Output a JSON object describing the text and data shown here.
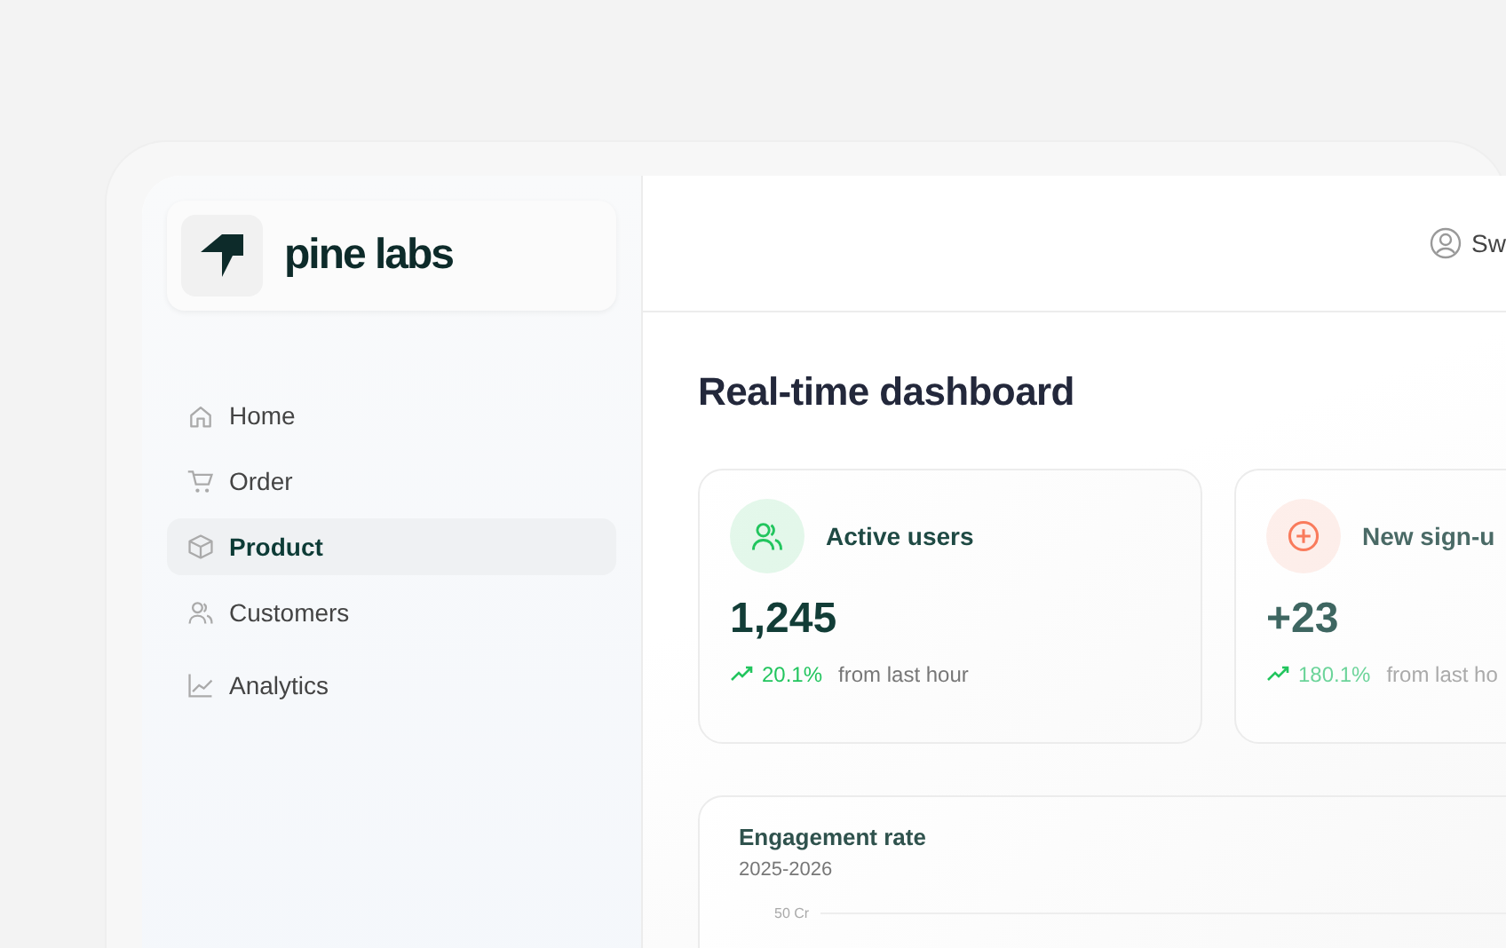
{
  "sidebar": {
    "logo_text": "pine labs",
    "items": [
      {
        "label": "Home",
        "selected": false
      },
      {
        "label": "Order",
        "selected": false
      },
      {
        "label": "Product",
        "selected": true
      },
      {
        "label": "Customers",
        "selected": false
      },
      {
        "label": "Analytics",
        "selected": false
      }
    ]
  },
  "header": {
    "user_name": "Sw"
  },
  "page_title": "Real-time dashboard",
  "stats": [
    {
      "title": "Active users",
      "color": "#22c55e",
      "value": "1,245",
      "change": "20.1%",
      "note": "from last hour"
    },
    {
      "title": "New sign-u",
      "color": "#f97b5c",
      "value": "+23",
      "change": "180.1%",
      "note": "from last ho"
    }
  ],
  "engagement": {
    "title": "Engagement rate",
    "subtitle": "2025-2026",
    "y_tick_label": "50 Cr"
  }
}
